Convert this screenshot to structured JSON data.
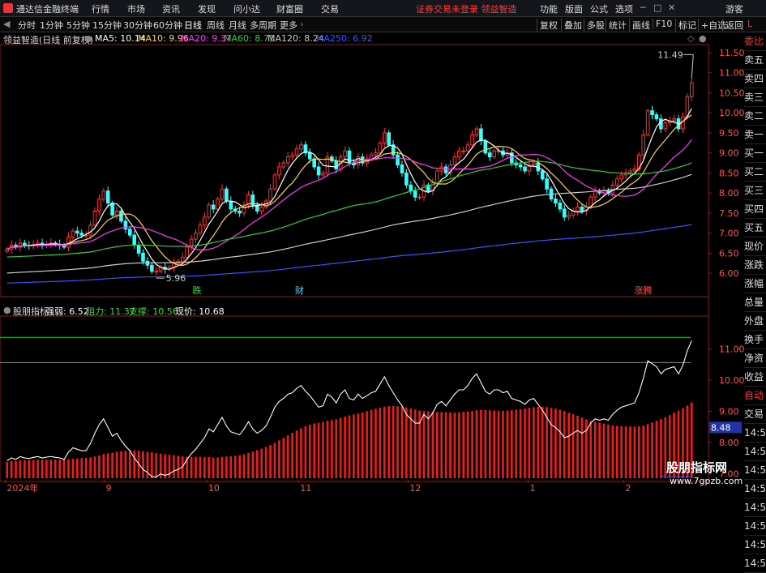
{
  "titlebar": {
    "app_name": "通达信金融终端",
    "menus": [
      "行情",
      "市场",
      "资讯",
      "发现",
      "问小达",
      "财富圈",
      "交易"
    ],
    "warning": "证券交易未登录  领益智造",
    "right_menus": [
      "功能",
      "版面",
      "公式",
      "选项"
    ],
    "user": "游客"
  },
  "toolbar": {
    "periods": [
      "分时",
      "1分钟",
      "5分钟",
      "15分钟",
      "30分钟",
      "60分钟",
      "日线",
      "周线",
      "月线",
      "多周期",
      "更多"
    ],
    "active_period": "日线",
    "right_buttons": [
      "复权",
      "叠加",
      "多股",
      "统计",
      "画线",
      "F10",
      "标记",
      "+自选",
      "返回"
    ]
  },
  "chart_info": {
    "title": "领益智造(日线 前复权)",
    "ma": [
      {
        "label": "MA5: 10.14",
        "color": "#ffffff"
      },
      {
        "label": "MA10: 9.96",
        "color": "#ffd34d"
      },
      {
        "label": "MA20: 9.37",
        "color": "#ff33ff"
      },
      {
        "label": "MA60: 8.71",
        "color": "#33cc33"
      },
      {
        "label": "MA120: 8.24",
        "color": "#cccccc"
      },
      {
        "label": "MA250: 6.92",
        "color": "#3355ff"
      }
    ]
  },
  "sidebar": [
    "委比",
    "卖五",
    "卖四",
    "卖三",
    "卖二",
    "卖一",
    "买一",
    "买二",
    "买三",
    "买四",
    "买五",
    "现价",
    "涨跌",
    "涨幅",
    "总量",
    "外盘",
    "换手",
    "净资",
    "收益",
    "自动",
    "交易",
    "14:56",
    "14:56",
    "14:56",
    "14:56",
    "14:56",
    "14:56",
    "14:56",
    "14:56"
  ],
  "chart_data": [
    {
      "type": "candlestick",
      "title": "领益智造(日线 前复权)",
      "ylim": [
        5.7,
        11.7
      ],
      "y_ticks": [
        "11.50",
        "11.00",
        "10.50",
        "10.00",
        "9.50",
        "9.00",
        "8.50",
        "8.00",
        "7.50",
        "7.00",
        "6.50",
        "6.00"
      ],
      "x_ticks": [
        "2024年",
        "9",
        "10",
        "11",
        "12",
        "1",
        "2"
      ],
      "annotations": {
        "high": "11.49",
        "low": "5.96"
      },
      "event_marks": [
        "跌",
        "财",
        "涨腾"
      ],
      "closes": [
        6.6,
        6.7,
        6.65,
        6.75,
        6.7,
        6.68,
        6.72,
        6.75,
        6.7,
        6.73,
        6.75,
        6.72,
        6.7,
        6.65,
        6.9,
        7.05,
        7.0,
        6.95,
        6.95,
        7.2,
        7.55,
        7.85,
        8.05,
        7.75,
        7.45,
        7.55,
        7.3,
        7.1,
        6.95,
        6.7,
        6.5,
        6.3,
        6.2,
        6.05,
        6.05,
        6.15,
        6.1,
        6.15,
        6.25,
        6.3,
        6.4,
        6.65,
        6.85,
        7.0,
        7.2,
        7.4,
        7.7,
        7.6,
        7.85,
        8.1,
        7.8,
        7.6,
        7.55,
        7.5,
        7.7,
        7.95,
        7.7,
        7.55,
        7.65,
        7.8,
        8.1,
        8.45,
        8.65,
        8.75,
        8.9,
        8.95,
        9.1,
        9.2,
        9.0,
        8.85,
        8.65,
        8.45,
        8.5,
        8.9,
        8.8,
        8.6,
        8.9,
        9.05,
        8.75,
        8.7,
        8.9,
        8.75,
        8.85,
        8.95,
        9.0,
        9.25,
        9.5,
        9.2,
        8.95,
        8.7,
        8.5,
        8.2,
        8.05,
        7.9,
        7.9,
        8.2,
        8.05,
        8.25,
        8.55,
        8.65,
        8.5,
        8.7,
        8.9,
        9.05,
        9.05,
        9.2,
        9.45,
        9.6,
        9.3,
        9.0,
        8.9,
        9.05,
        9.05,
        8.95,
        9.0,
        8.75,
        8.7,
        8.65,
        8.55,
        8.7,
        8.75,
        8.55,
        8.35,
        8.1,
        7.85,
        7.75,
        7.6,
        7.4,
        7.45,
        7.55,
        7.65,
        7.55,
        7.65,
        7.9,
        8.05,
        8.0,
        8.05,
        8.0,
        8.2,
        8.35,
        8.45,
        8.5,
        8.55,
        8.6,
        8.95,
        9.45,
        10.05,
        9.95,
        9.85,
        9.6,
        9.75,
        9.8,
        9.85,
        9.6,
        9.9,
        10.4,
        10.75
      ],
      "series": [
        {
          "name": "MA5",
          "color": "#ffffff"
        },
        {
          "name": "MA10",
          "color": "#ffd34d"
        },
        {
          "name": "MA20",
          "color": "#ff33ff"
        },
        {
          "name": "MA60",
          "color": "#33cc33"
        },
        {
          "name": "MA120",
          "color": "#cccccc"
        },
        {
          "name": "MA250",
          "color": "#3355ff"
        }
      ]
    },
    {
      "type": "bar+line",
      "title": "股朋指标",
      "ylim": [
        6.8,
        12.0
      ],
      "y_ticks": [
        "11.00",
        "10.00",
        "9.00",
        "8.00",
        "7.00"
      ],
      "current_label": "8.48",
      "readouts": [
        {
          "label": "强弱: 6.52",
          "color": "#ffffff"
        },
        {
          "label": "阻力: 11.37",
          "color": "#33dd33"
        },
        {
          "label": "支撑: 10.56",
          "color": "#33dd33"
        },
        {
          "label": "现价: 10.68",
          "color": "#ffffff"
        }
      ],
      "resistance": 11.37,
      "support": 10.56,
      "bars_end": 9.28
    }
  ],
  "watermark": {
    "line1": "股朋指标网",
    "line2": "www.7gpzb.com"
  }
}
